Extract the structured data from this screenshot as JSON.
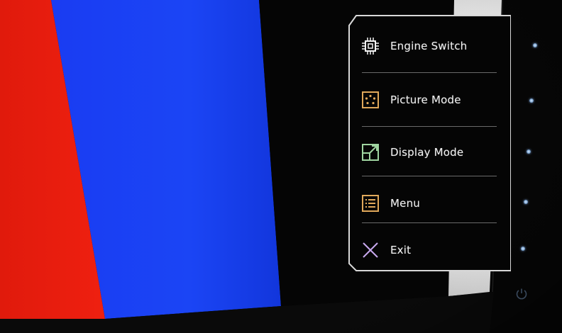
{
  "osd": {
    "items": [
      {
        "label": "Engine Switch",
        "icon": "chip-icon"
      },
      {
        "label": "Picture Mode",
        "icon": "picture-mode-icon"
      },
      {
        "label": "Display Mode",
        "icon": "display-mode-icon"
      },
      {
        "label": "Menu",
        "icon": "menu-list-icon"
      },
      {
        "label": "Exit",
        "icon": "close-x-icon"
      }
    ]
  },
  "colors": {
    "screen_red": "#e8160b",
    "screen_blue": "#1640f0",
    "osd_background": "#050505",
    "icon_white": "#f4f4f4",
    "icon_orange": "#e0a85a",
    "icon_green": "#9fd4a0",
    "icon_lavender": "#c8a8ee"
  }
}
